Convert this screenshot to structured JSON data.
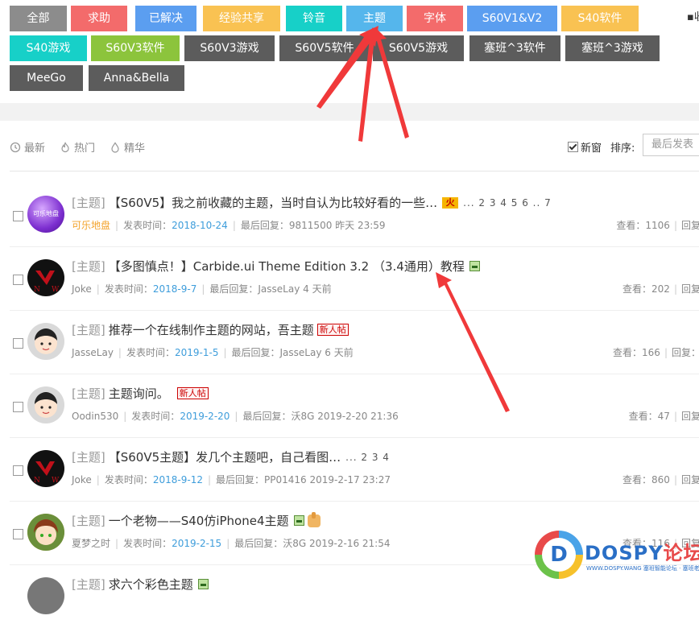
{
  "tags": [
    {
      "label": "全部",
      "color": "#8c8c8c"
    },
    {
      "label": "求助",
      "color": "#f36b6b"
    },
    {
      "label": "已解决",
      "color": "#5b9ef0"
    },
    {
      "label": "经验共享",
      "color": "#f9c252"
    },
    {
      "label": "铃音",
      "color": "#17d0c8"
    },
    {
      "label": "主题",
      "color": "#55b6ec"
    },
    {
      "label": "字体",
      "color": "#f36b6b"
    },
    {
      "label": "S60V1&V2",
      "color": "#5b9ef0"
    },
    {
      "label": "S40软件",
      "color": "#f9c252"
    },
    {
      "label": "S40游戏",
      "color": "#17d0c8"
    },
    {
      "label": "S60V3软件",
      "color": "#8cc43c"
    },
    {
      "label": "S60V3游戏",
      "color": "#5c5c5c"
    },
    {
      "label": "S60V5软件",
      "color": "#5c5c5c"
    },
    {
      "label": "S60V5游戏",
      "color": "#5c5c5c"
    },
    {
      "label": "塞班^3软件",
      "color": "#5c5c5c"
    },
    {
      "label": "塞班^3游戏",
      "color": "#5c5c5c"
    },
    {
      "label": "MeeGo",
      "color": "#5c5c5c"
    },
    {
      "label": "Anna&Bella",
      "color": "#5c5c5c"
    }
  ],
  "collect_label": "收",
  "filters": {
    "latest": "最新",
    "hot": "热门",
    "digest": "精华"
  },
  "new_window_label": "新窗",
  "sort_label": "排序:",
  "sort_value": "最后发表",
  "rows": [
    {
      "category": "[主题]",
      "title": "【S60V5】我之前收藏的主题，当时自认为比较好看的一些…",
      "pages": "... 2 3 4 5 6 .. 7",
      "author": "可乐地盘",
      "posted_label": "发表时间：",
      "posted": "2018-10-24",
      "last_label": "最后回复：",
      "last": "9811500 昨天 23:59",
      "views": "查看：1106",
      "replies": "回复",
      "avatar_text": "可乐地盘"
    },
    {
      "category": "[主题]",
      "title": "【多图慎点！】Carbide.ui Theme Edition 3.2 （3.4通用）教程",
      "author": "Joke",
      "posted_label": "发表时间：",
      "posted": "2018-9-7",
      "last_label": "最后回复：",
      "last": "JasseLay 4 天前",
      "views": "查看：202",
      "replies": "回复"
    },
    {
      "category": "[主题]",
      "title": "推荐一个在线制作主题的网站，吾主题",
      "badge": "新人帖",
      "author": "JasseLay",
      "posted_label": "发表时间：",
      "posted": "2019-1-5",
      "last_label": "最后回复：",
      "last": "JasseLay 6 天前",
      "views": "查看：166",
      "replies": "回复："
    },
    {
      "category": "[主题]",
      "title": "主题询问。",
      "badge": "新人帖",
      "author": "Oodin530",
      "posted_label": "发表时间：",
      "posted": "2019-2-20",
      "last_label": "最后回复：",
      "last": "沃8G 2019-2-20 21:36",
      "views": "查看：47",
      "replies": "回复"
    },
    {
      "category": "[主题]",
      "title": "【S60V5主题】发几个主题吧，自己看图…",
      "pages": "... 2 3 4",
      "author": "Joke",
      "posted_label": "发表时间：",
      "posted": "2018-9-12",
      "last_label": "最后回复：",
      "last": "PP01416 2019-2-17 23:27",
      "views": "查看：860",
      "replies": "回复"
    },
    {
      "category": "[主题]",
      "title": "一个老物——S40仿iPhone4主题",
      "author": "夏梦之时",
      "posted_label": "发表时间：",
      "posted": "2019-2-15",
      "last_label": "最后回复：",
      "last": "沃8G 2019-2-16 21:54",
      "views": "查看：116",
      "replies": "回复"
    },
    {
      "category": "[主题]",
      "title": "求六个彩色主题"
    }
  ],
  "logo": {
    "word": "DOSPY",
    "word_cn": "论坛",
    "sub": "WWW.DOSPY.WANG 塞班智能论坛 · 塞班老用户",
    "mark": "D"
  },
  "colors": {
    "arrow": "#f0393a",
    "link": "#3e9ddb"
  }
}
